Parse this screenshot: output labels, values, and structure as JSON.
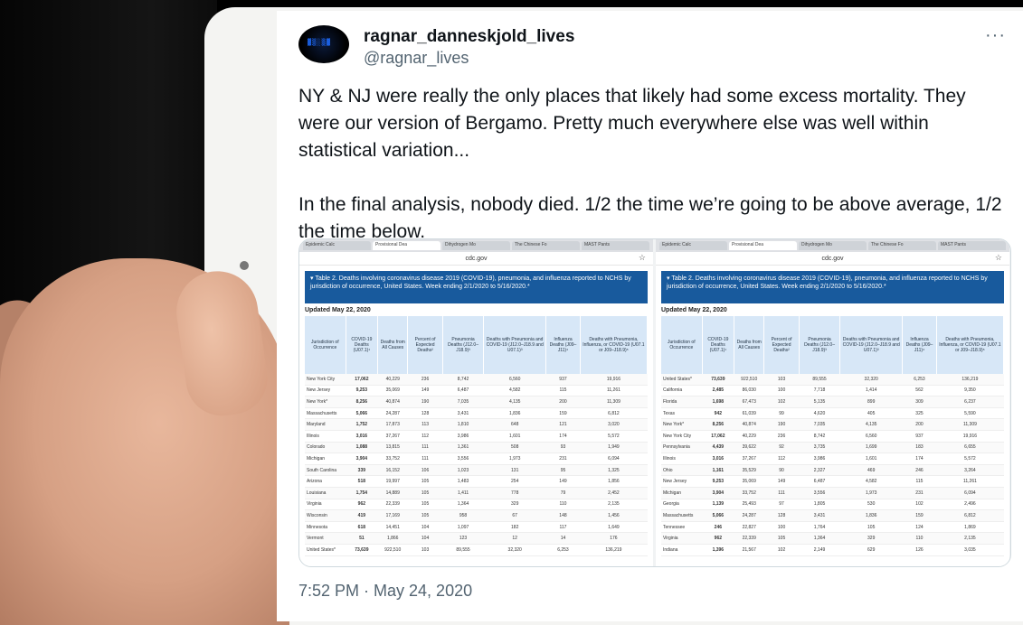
{
  "tweet": {
    "display_name": "ragnar_danneskjold_lives",
    "handle": "@ragnar_lives",
    "more": "···",
    "text": "NY & NJ were really the only places that likely had some excess mortality. They were our version of Bergamo. Pretty much everywhere else was well within statistical variation...\n\nIn the final analysis, nobody died. 1/2 the time we’re going to be above average, 1/2 the time below.",
    "timestamp": "7:52 PM · May 24, 2020"
  },
  "screenshot": {
    "url": "cdc.gov",
    "tabs": [
      "Epidemic Calc",
      "Provisional Dea",
      "Dihydrogen Mo",
      "The Chinese Fo",
      "MAST Pants"
    ],
    "banner": "▾ Table 2. Deaths involving coronavirus disease 2019 (COVID-19), pneumonia, and influenza reported to NCHS by jurisdiction of occurrence, United States. Week ending 2/1/2020 to 5/16/2020.*",
    "updated": "Updated May 22, 2020",
    "columns": [
      "Jurisdiction of Occurrence",
      "COVID-19 Deaths (U07.1)¹",
      "Deaths from All Causes",
      "Percent of Expected Deaths²",
      "Pneumonia Deaths (J12.0–J18.9)³",
      "Deaths with Pneumonia and COVID-19 (J12.0–J18.9 and U07.1)³",
      "Influenza Deaths (J09–J11)⁴",
      "Deaths with Pneumonia, Influenza, or COVID-19 (U07.1 or J09–J18.9)⁵"
    ],
    "left_rows": [
      [
        "New York City",
        "17,062",
        "40,229",
        "236",
        "8,742",
        "6,560",
        "937",
        "19,916"
      ],
      [
        "New Jersey",
        "9,253",
        "35,069",
        "149",
        "6,487",
        "4,582",
        "115",
        "11,261"
      ],
      [
        "New York*",
        "8,256",
        "40,874",
        "190",
        "7,035",
        "4,135",
        "200",
        "11,309"
      ],
      [
        "Massachusetts",
        "5,066",
        "24,287",
        "128",
        "3,431",
        "1,836",
        "159",
        "6,812"
      ],
      [
        "Maryland",
        "1,752",
        "17,873",
        "113",
        "1,810",
        "648",
        "121",
        "3,020"
      ],
      [
        "Illinois",
        "3,016",
        "37,267",
        "112",
        "3,986",
        "1,601",
        "174",
        "5,572"
      ],
      [
        "Colorado",
        "1,088",
        "13,815",
        "111",
        "1,361",
        "508",
        "93",
        "1,949"
      ],
      [
        "Michigan",
        "3,904",
        "33,752",
        "111",
        "3,556",
        "1,973",
        "231",
        "6,094"
      ],
      [
        "South Carolina",
        "339",
        "16,152",
        "106",
        "1,023",
        "131",
        "95",
        "1,325"
      ],
      [
        "Arizona",
        "518",
        "19,997",
        "105",
        "1,483",
        "254",
        "149",
        "1,856"
      ],
      [
        "Louisiana",
        "1,754",
        "14,889",
        "105",
        "1,411",
        "778",
        "79",
        "2,452"
      ],
      [
        "Virginia",
        "962",
        "22,339",
        "105",
        "1,364",
        "329",
        "110",
        "2,135"
      ],
      [
        "Wisconsin",
        "419",
        "17,169",
        "105",
        "958",
        "67",
        "148",
        "1,456"
      ],
      [
        "Minnesota",
        "618",
        "14,451",
        "104",
        "1,097",
        "182",
        "117",
        "1,649"
      ],
      [
        "Vermont",
        "51",
        "1,866",
        "104",
        "123",
        "12",
        "14",
        "176"
      ],
      [
        "United States*",
        "73,639",
        "922,510",
        "103",
        "89,555",
        "32,320",
        "6,253",
        "136,219"
      ]
    ],
    "right_rows": [
      [
        "United States*",
        "73,639",
        "922,510",
        "103",
        "89,555",
        "32,320",
        "6,253",
        "136,219"
      ],
      [
        "California",
        "2,485",
        "86,030",
        "100",
        "7,718",
        "1,414",
        "562",
        "9,350"
      ],
      [
        "Florida",
        "1,698",
        "67,473",
        "102",
        "5,135",
        "899",
        "309",
        "6,237"
      ],
      [
        "Texas",
        "942",
        "61,039",
        "99",
        "4,620",
        "405",
        "325",
        "5,590"
      ],
      [
        "New York*",
        "8,256",
        "40,874",
        "190",
        "7,035",
        "4,135",
        "200",
        "11,309"
      ],
      [
        "New York City",
        "17,062",
        "40,229",
        "236",
        "8,742",
        "6,560",
        "937",
        "19,916"
      ],
      [
        "Pennsylvania",
        "4,439",
        "39,622",
        "92",
        "3,735",
        "1,699",
        "183",
        "6,655"
      ],
      [
        "Illinois",
        "3,016",
        "37,267",
        "112",
        "3,986",
        "1,601",
        "174",
        "5,572"
      ],
      [
        "Ohio",
        "1,161",
        "35,529",
        "90",
        "2,327",
        "469",
        "246",
        "3,264"
      ],
      [
        "New Jersey",
        "9,253",
        "35,069",
        "149",
        "6,487",
        "4,582",
        "115",
        "11,261"
      ],
      [
        "Michigan",
        "3,904",
        "33,752",
        "111",
        "3,556",
        "1,973",
        "231",
        "6,094"
      ],
      [
        "Georgia",
        "1,139",
        "25,493",
        "97",
        "1,805",
        "530",
        "102",
        "2,496"
      ],
      [
        "Massachusetts",
        "5,066",
        "24,287",
        "128",
        "3,431",
        "1,836",
        "159",
        "6,812"
      ],
      [
        "Tennessee",
        "246",
        "22,827",
        "100",
        "1,764",
        "105",
        "124",
        "1,869"
      ],
      [
        "Virginia",
        "962",
        "22,339",
        "105",
        "1,364",
        "329",
        "110",
        "2,135"
      ],
      [
        "Indiana",
        "1,396",
        "21,567",
        "102",
        "2,149",
        "629",
        "126",
        "3,035"
      ]
    ]
  }
}
